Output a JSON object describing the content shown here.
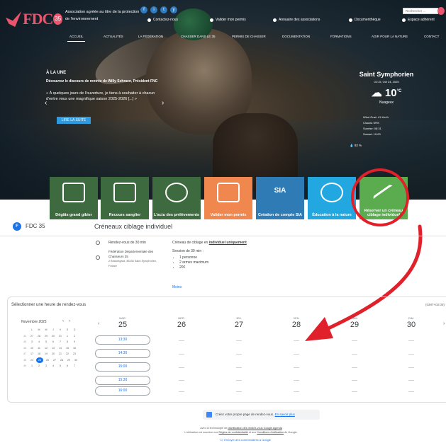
{
  "site": {
    "logo_text": "FDC",
    "logo_num": "35",
    "tagline": "Association agréée au titre de la protection de l'environnement",
    "social": [
      "f",
      "i",
      "t",
      "y"
    ],
    "top_links": [
      "Contactez-nous",
      "Valider mon permis",
      "Annuaire des associations",
      "Documenthèque",
      "Espace adhérent"
    ],
    "search_placeholder": "Rechercher ...",
    "nav": [
      "ACCUEIL",
      "ACTUALITÉS",
      "LA FÉDÉRATION",
      "CHASSER DANS LE 35",
      "PERMIS DE CHASSER",
      "DOCUMENTATION",
      "FORMATIONS",
      "AGIR POUR LA NATURE",
      "CONTACT"
    ]
  },
  "hero": {
    "label": "À LA UNE",
    "title": "Découvrez le discours de rentrée de Willy Schraen, Président FNC",
    "text": "« À quelques jours de l'ouverture, je tiens à souhaiter à chacun d'entre vous une magnifique saison 2025-2026 [...] »",
    "cta": "LIRE LA SUITE",
    "prev": "‹",
    "next": "›"
  },
  "weather": {
    "city": "Saint Symphorien",
    "date": "02:15, Oct 24, 2025",
    "temp": "10",
    "unit": "°C",
    "condition": "Nuageux",
    "details": [
      "Wind Gust: 41 Km/h",
      "Clouds: 69%",
      "Sunrise: 08:31",
      "Sunset: 19:00"
    ],
    "humidity": "92 %"
  },
  "tiles": [
    {
      "label": "Dégâts grand gibier",
      "color": "#3d6b3f"
    },
    {
      "label": "Recours sanglier",
      "color": "#3d6b3f"
    },
    {
      "label": "L'actu des prélèvements",
      "color": "#3d6b3f"
    },
    {
      "label": "Valider mon permis",
      "color": "#f0874f"
    },
    {
      "label": "Création de compte SIA",
      "color": "#2e7bb6"
    },
    {
      "label": "Éducation à la nature",
      "color": "#22a7e0"
    },
    {
      "label": "Réserver un créneau ciblage individuel",
      "color": "#5aac4f"
    }
  ],
  "tile_icon_text": "SIA",
  "booking": {
    "org_initial": "F",
    "org_name": "FDC 35",
    "title": "Créneaux ciblage individuel",
    "duration": "Rendez-vous de 30 min",
    "place": "Fédération Départementale des Chasseurs 35",
    "address": "2 Beauregard, 35430 Saint-Symphorien, France",
    "desc_line1": "Créneau de ciblage en ",
    "desc_bold": "individuel uniquement",
    "desc_session": "Session de 30 min :",
    "bullets": [
      "1 personne",
      "2 armes maximum",
      "20€"
    ],
    "more": "Moins"
  },
  "calendar": {
    "title": "Sélectionner une heure de rendez-vous",
    "timezone": "(GMT+02:00)",
    "month": "Novembre 2025",
    "weekdays": [
      "L",
      "M",
      "M",
      "J",
      "V",
      "S",
      "D"
    ],
    "weeks": [
      {
        "wk": "44",
        "days": [
          "27",
          "28",
          "29",
          "30",
          "31",
          "1",
          "2"
        ]
      },
      {
        "wk": "45",
        "days": [
          "3",
          "4",
          "5",
          "6",
          "7",
          "8",
          "9"
        ]
      },
      {
        "wk": "46",
        "days": [
          "10",
          "11",
          "12",
          "13",
          "14",
          "15",
          "16"
        ]
      },
      {
        "wk": "47",
        "days": [
          "17",
          "18",
          "19",
          "20",
          "21",
          "22",
          "23"
        ]
      },
      {
        "wk": "48",
        "days": [
          "24",
          "25",
          "26",
          "27",
          "28",
          "29",
          "30"
        ]
      },
      {
        "wk": "49",
        "days": [
          "1",
          "2",
          "3",
          "4",
          "5",
          "6",
          "7"
        ]
      }
    ],
    "today": "25",
    "days": [
      {
        "name": "MAR.",
        "num": "25"
      },
      {
        "name": "MER.",
        "num": "26"
      },
      {
        "name": "JEU.",
        "num": "27"
      },
      {
        "name": "VEN.",
        "num": "28"
      },
      {
        "name": "SAM.",
        "num": "29"
      },
      {
        "name": "DIM.",
        "num": "30"
      }
    ],
    "slots": [
      "13:30",
      "14:30",
      "15:00",
      "15:30",
      "16:00"
    ]
  },
  "footer": {
    "cta_text": "Créez votre propre page de rendez-vous.",
    "cta_link": "En savoir plus",
    "legal_1": "Avec la technologie de ",
    "legal_link1": "planification des rendez-vous Google Agenda",
    "legal_2": "L'utilisation est soumise aux ",
    "legal_link2": "Règles de confidentialité",
    "legal_3": " et aux ",
    "legal_link3": "Conditions d'utilisation",
    "legal_4": " de Google.",
    "feedback": "Envoyer des commentaires à Google"
  },
  "colors": {
    "accent": "#1a73e8",
    "brand": "#e8556d",
    "highlight": "#e0202a"
  }
}
